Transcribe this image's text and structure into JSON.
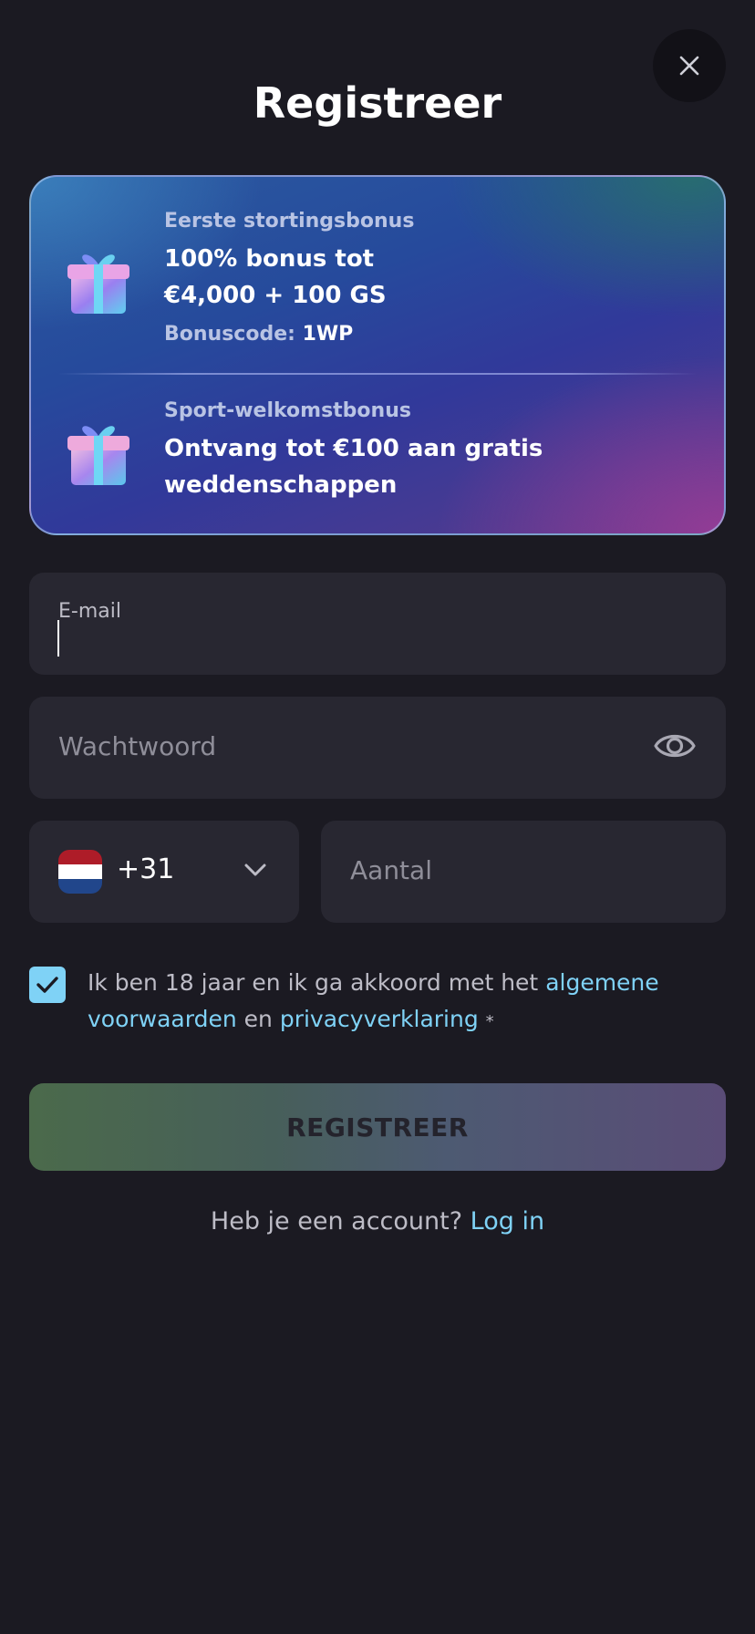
{
  "header": {
    "title": "Registreer"
  },
  "bonuses": [
    {
      "subtitle": "Eerste stortingsbonus",
      "line1": "100% bonus tot",
      "line2": "€4,000 + 100 GS",
      "code_label": "Bonuscode:",
      "code_value": "1WP"
    },
    {
      "subtitle": "Sport-welkomstbonus",
      "line1": "Ontvang tot €100 aan gratis",
      "line2": "weddenschappen"
    }
  ],
  "form": {
    "email": {
      "label": "E-mail",
      "value": ""
    },
    "password": {
      "placeholder": "Wachtwoord"
    },
    "phone": {
      "country_code": "+31",
      "placeholder": "Aantal"
    },
    "terms": {
      "checked": true,
      "text_before": "Ik ben 18 jaar en ik ga akkoord met het",
      "link1": "algemene voorwaarden",
      "middle": "en",
      "link2": "privacyverklaring",
      "asterisk": "*"
    },
    "submit_label": "REGISTREER"
  },
  "footer": {
    "question": "Heb je een account?",
    "login_link": "Log in"
  },
  "colors": {
    "background": "#1b1a22",
    "field": "#282731",
    "accent_link": "#7fd2f6"
  },
  "icons": {
    "close": "close-icon",
    "gift": "gift-icon",
    "eye": "eye-icon",
    "flag": "netherlands-flag-icon",
    "chevron": "chevron-down-icon",
    "check": "check-icon"
  }
}
